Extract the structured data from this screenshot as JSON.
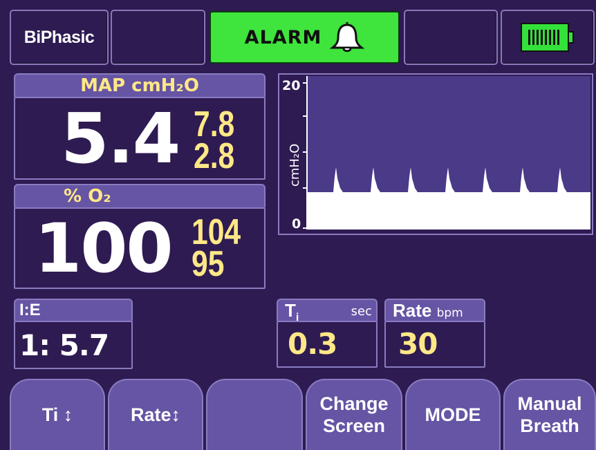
{
  "status_bar": {
    "mode": "BiPhasic",
    "alarm_label": "ALARM"
  },
  "map_panel": {
    "title": "MAP cmH₂O",
    "value": "5.4",
    "upper_limit": "7.8",
    "lower_limit": "2.8"
  },
  "o2_panel": {
    "title": "% O₂",
    "value": "100",
    "upper_limit": "104",
    "lower_limit": "95"
  },
  "ie_panel": {
    "title": "I:E",
    "value": "1: 5.7"
  },
  "ti_panel": {
    "title": "T",
    "title_sub": "i",
    "unit": "sec",
    "value": "0.3"
  },
  "rate_panel": {
    "title": "Rate",
    "unit": "bpm",
    "value": "30"
  },
  "waveform": {
    "ylabel": "cmH₂O",
    "y_max_label": "20",
    "y_min_label": "0"
  },
  "softkeys": {
    "ti": "Ti ↕",
    "rate": "Rate↕",
    "blank": "",
    "change_screen_1": "Change",
    "change_screen_2": "Screen",
    "mode": "MODE",
    "manual_1": "Manual",
    "manual_2": "Breath"
  },
  "colors": {
    "background": "#2e1b52",
    "panel_header": "#6654a4",
    "limits_text": "#ffe887",
    "alarm_green": "#3fe43c",
    "battery_green": "#34e13a"
  },
  "icons": {
    "alarm": "bell-icon",
    "battery": "battery-full-icon",
    "arrows": "up-down-arrow-icon"
  }
}
